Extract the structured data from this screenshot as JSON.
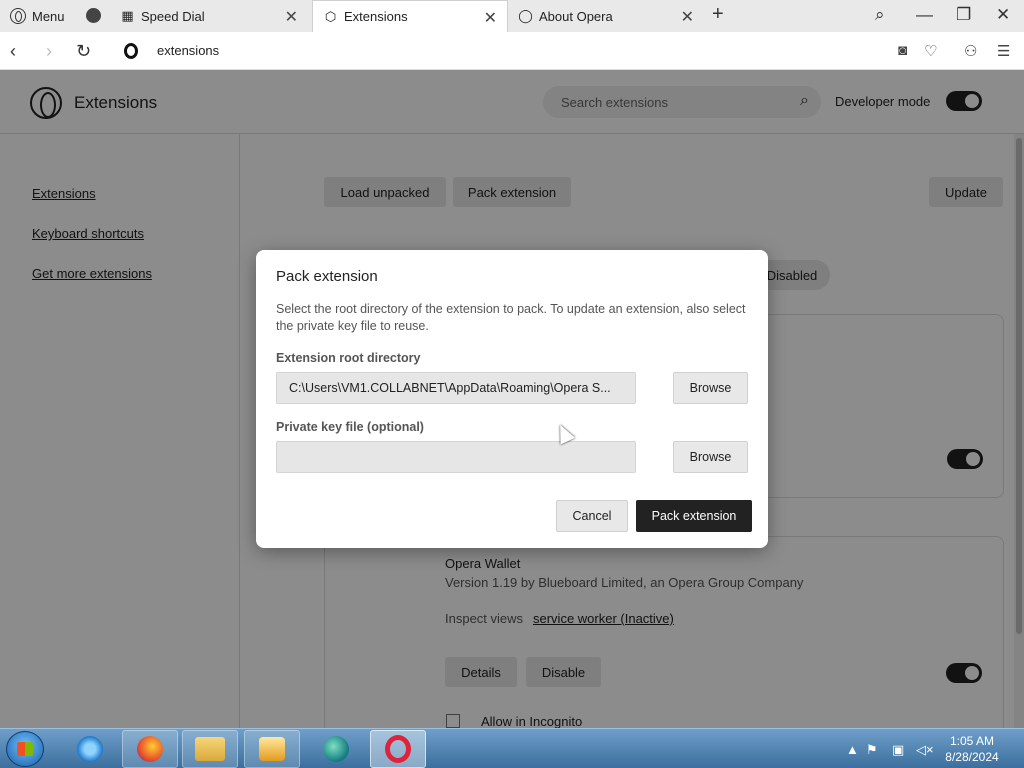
{
  "tabbar": {
    "menu_label": "Menu",
    "tabs": [
      {
        "label": "Speed Dial",
        "icon": "grid-icon"
      },
      {
        "label": "Extensions",
        "icon": "cube-icon"
      },
      {
        "label": "About Opera",
        "icon": "opera-icon"
      }
    ],
    "new_tab_glyph": "+"
  },
  "addressbar": {
    "url": "extensions"
  },
  "page": {
    "title": "Extensions",
    "search_placeholder": "Search extensions",
    "developer_mode_label": "Developer mode",
    "developer_mode_on": true,
    "sidebar_links": [
      "Extensions",
      "Keyboard shortcuts",
      "Get more extensions"
    ],
    "toolbar": {
      "load_unpacked": "Load unpacked",
      "pack_extension": "Pack extension",
      "update": "Update"
    },
    "filter_disabled": "Disabled",
    "extension": {
      "name": "Opera Wallet",
      "version_line": "Version 1.19 by Blueboard Limited, an Opera Group Company",
      "inspect_label": "Inspect views",
      "inspect_link": "service worker (Inactive)",
      "details_button": "Details",
      "disable_button": "Disable",
      "incognito_label": "Allow in Incognito",
      "enabled": true
    }
  },
  "dialog": {
    "title": "Pack extension",
    "description": "Select the root directory of the extension to pack. To update an extension, also select the private key file to reuse.",
    "root_label": "Extension root directory",
    "root_value": "C:\\Users\\VM1.COLLABNET\\AppData\\Roaming\\Opera S...",
    "key_label": "Private key file (optional)",
    "key_value": "",
    "browse_label": "Browse",
    "cancel_label": "Cancel",
    "pack_label": "Pack extension"
  },
  "taskbar": {
    "time": "1:05 AM",
    "date": "8/28/2024",
    "apps": [
      "internet-explorer-icon",
      "firefox-icon",
      "file-explorer-icon",
      "media-player-icon",
      "edge-icon",
      "opera-icon"
    ]
  },
  "colors": {
    "toggle_on": "#222222",
    "primary_button": "#222222",
    "wallet_icon": "#16a39a",
    "taskbar": "#4a7fae"
  }
}
